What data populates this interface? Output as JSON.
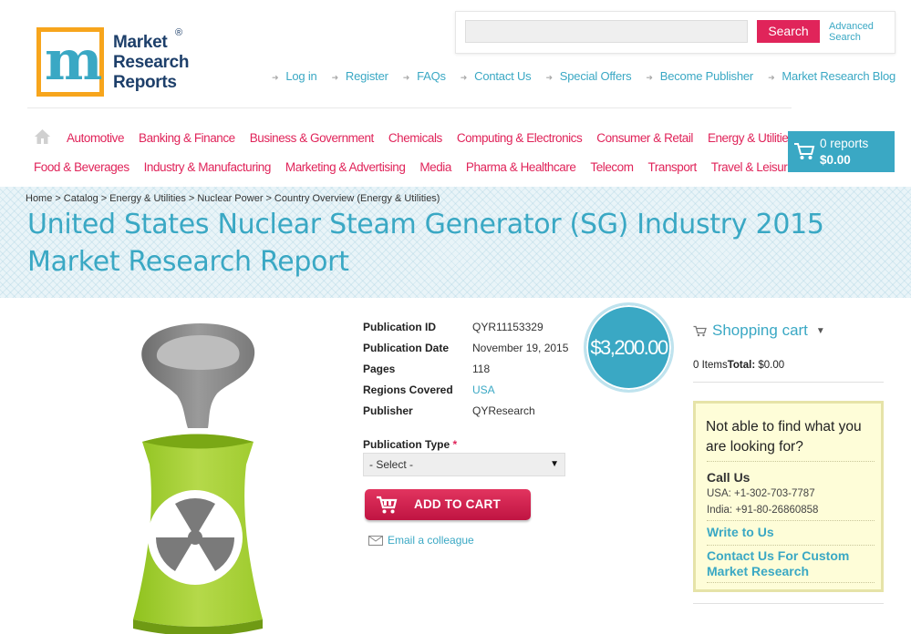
{
  "logo": {
    "letter": "m",
    "line1": "Market",
    "line2": "Research",
    "line3": "Reports",
    "reg": "®"
  },
  "search": {
    "placeholder": "",
    "button_label": "Search",
    "advanced_line1": "Advanced",
    "advanced_line2": "Search"
  },
  "top_links": [
    "Log in",
    "Register",
    "FAQs",
    "Contact Us",
    "Special Offers",
    "Become Publisher",
    "Market Research Blog"
  ],
  "nav": {
    "row1": [
      "Automotive",
      "Banking & Finance",
      "Business & Government",
      "Chemicals",
      "Computing & Electronics",
      "Consumer & Retail",
      "Energy & Utilities"
    ],
    "row2": [
      "Food & Beverages",
      "Industry & Manufacturing",
      "Marketing & Advertising",
      "Media",
      "Pharma & Healthcare",
      "Telecom",
      "Transport",
      "Travel & Leisure"
    ]
  },
  "cart_summary": {
    "count": "0 reports",
    "total": "$0.00"
  },
  "breadcrumb": [
    "Home",
    "Catalog",
    "Energy & Utilities",
    "Nuclear Power",
    "Country Overview (Energy & Utilities)"
  ],
  "breadcrumb_sep": ">",
  "title": "United States Nuclear Steam Generator (SG) Industry 2015 Market Research Report",
  "details": [
    {
      "label": "Publication ID",
      "value": "QYR11153329"
    },
    {
      "label": "Publication Date",
      "value": "November 19, 2015"
    },
    {
      "label": "Pages",
      "value": "118"
    },
    {
      "label": "Regions Covered",
      "value": "USA"
    },
    {
      "label": "Publisher",
      "value": "QYResearch"
    }
  ],
  "price": "$3,200.00",
  "publication_type": {
    "label": "Publication Type",
    "required": "*",
    "selected": "- Select -"
  },
  "add_to_cart": "ADD TO CART",
  "email_colleague": "Email a colleague",
  "shopping_cart": {
    "title": "Shopping cart",
    "items": "0 Items",
    "total_label": "Total:",
    "total": "$0.00"
  },
  "help": {
    "title": "Not able to find what you are looking for?",
    "call_us": "Call Us",
    "usa": "USA: +1-302-703-7787",
    "india": "India: +91-80-26860858",
    "write_to_us": "Write to Us",
    "custom_line1": "Contact Us For Custom",
    "custom_line2": "Market Research"
  },
  "colors": {
    "accent": "#3aa8c4",
    "brand_pink": "#e0245a",
    "logo_orange": "#f7a51c"
  },
  "icons": [
    "home-icon",
    "cart-icon",
    "envelope-icon",
    "radiation-icon",
    "chevron-down-icon"
  ]
}
